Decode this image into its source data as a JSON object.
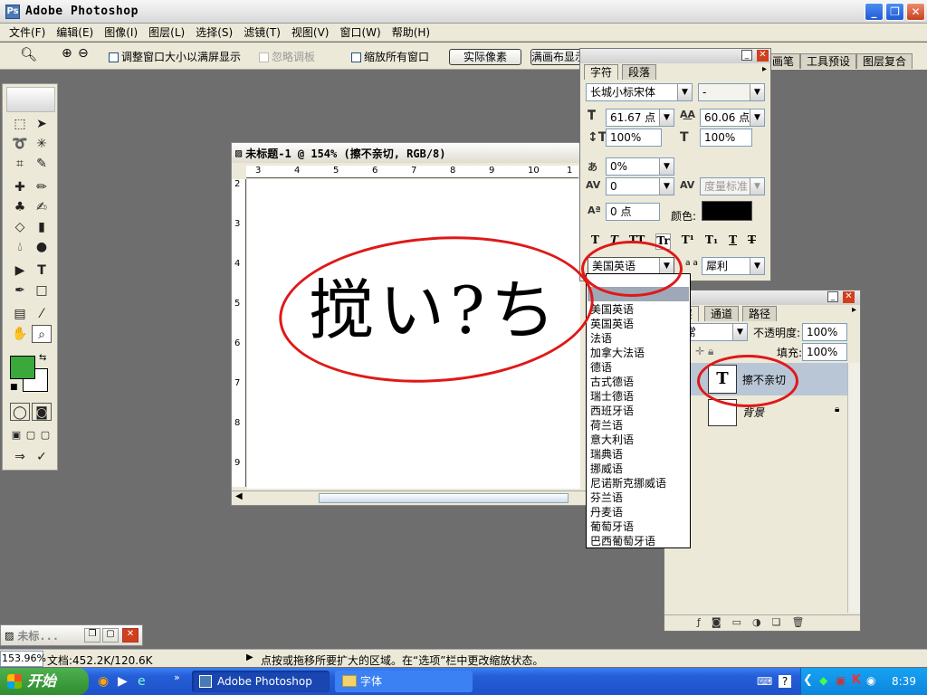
{
  "window": {
    "title": "Adobe Photoshop"
  },
  "menu": [
    "文件(F)",
    "编辑(E)",
    "图像(I)",
    "图层(L)",
    "选择(S)",
    "滤镜(T)",
    "视图(V)",
    "窗口(W)",
    "帮助(H)"
  ],
  "options": {
    "resize_windows": "调整窗口大小以满屏显示",
    "ignore_palettes": "忽略调板",
    "zoom_all": "缩放所有窗口",
    "actual_pixels": "实际像素",
    "fit_screen": "满画布显示",
    "palette_tabs": [
      "画笔",
      "工具预设",
      "图层复合"
    ]
  },
  "document": {
    "title": "未标题-1 @ 154% (擦不亲切, RGB/8)",
    "sample_text": "搅い?ち",
    "ruler_h": [
      "3",
      "4",
      "5",
      "6",
      "7",
      "8",
      "9",
      "10",
      "1"
    ],
    "ruler_v": [
      "2",
      "3",
      "4",
      "5",
      "6",
      "7",
      "8",
      "9"
    ]
  },
  "character_panel": {
    "tabs": [
      "字符",
      "段落"
    ],
    "font_family": "长城小标宋体",
    "font_style": "-",
    "font_size": "61.67 点",
    "leading": "60.06 点",
    "vertical_scale": "100%",
    "horizontal_scale": "100%",
    "tsume": "0%",
    "tracking": "0",
    "kerning": "度量标准",
    "baseline_shift": "0 点",
    "color_label": "颜色:",
    "color": "#000000",
    "style_buttons": [
      "T",
      "T",
      "TT",
      "Tr",
      "T¹",
      "T₁",
      "T",
      "T"
    ],
    "language": "美国英语",
    "aa_label": "a a",
    "antialias": "犀利"
  },
  "language_list": [
    "美国英语",
    "英国英语",
    "法语",
    "加拿大法语",
    "德语",
    "古式德语",
    "瑞士德语",
    "西班牙语",
    "荷兰语",
    "意大利语",
    "瑞典语",
    "挪威语",
    "尼诺斯克挪威语",
    "芬兰语",
    "丹麦语",
    "葡萄牙语",
    "巴西葡萄牙语"
  ],
  "layers_panel": {
    "tabs": [
      "图层",
      "通道",
      "路径"
    ],
    "blend_mode": "正常",
    "opacity_label": "不透明度:",
    "opacity": "100%",
    "fill_label": "填充:",
    "fill": "100%",
    "layers": [
      {
        "name": "擦不亲切",
        "type": "text"
      },
      {
        "name": "背景",
        "type": "background"
      }
    ]
  },
  "mini_window": {
    "title": "未标..."
  },
  "status": {
    "zoom": "153.96%",
    "doc_size": "文档:452.2K/120.6K",
    "hint": "点按或拖移所要扩大的区域。在“选项”栏中更改缩放状态。"
  },
  "taskbar": {
    "start": "开始",
    "items": [
      "Adobe Photoshop",
      "字体"
    ],
    "clock": "8:39"
  },
  "colors": {
    "foreground": "#3aa83a",
    "background": "#ffffff",
    "annotation": "#e01818"
  }
}
